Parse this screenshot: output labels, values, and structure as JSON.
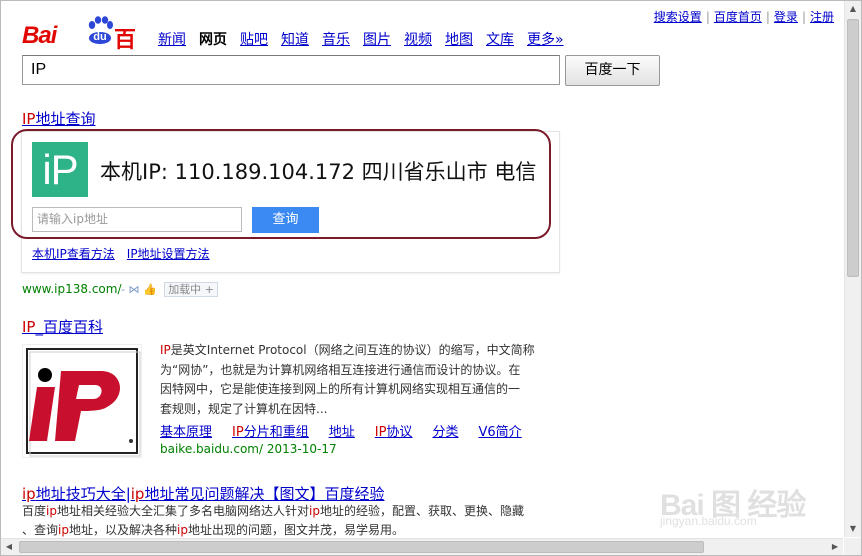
{
  "header": {
    "top_links": [
      "搜索设置",
      "百度首页",
      "登录",
      "注册"
    ],
    "logo": {
      "latin": "Bai",
      "du": "du",
      "chinese": "百度"
    },
    "nav": [
      {
        "label": "新闻",
        "active": false
      },
      {
        "label": "网页",
        "active": true
      },
      {
        "label": "贴吧",
        "active": false
      },
      {
        "label": "知道",
        "active": false
      },
      {
        "label": "音乐",
        "active": false
      },
      {
        "label": "图片",
        "active": false
      },
      {
        "label": "视频",
        "active": false
      },
      {
        "label": "地图",
        "active": false
      },
      {
        "label": "文库",
        "active": false
      },
      {
        "label": "更多»",
        "active": false
      }
    ]
  },
  "search": {
    "query": "IP",
    "button_label": "百度一下"
  },
  "result_ip": {
    "title_em": "IP",
    "title_rest": "地址查询",
    "logo_text": "iP",
    "ip_line": "本机IP: 110.189.104.172  四川省乐山市 电信",
    "input_placeholder": "请输入ip地址",
    "query_button": "查询",
    "links": [
      "本机IP查看方法",
      "IP地址设置方法"
    ],
    "cite": "www.ip138.com/",
    "cite_dash": "-",
    "loading_label": "加载中"
  },
  "result_baike": {
    "title_em": "IP",
    "title_rest": "_百度百科",
    "desc_lines": [
      {
        "em": "IP",
        "text": "是英文Internet Protocol（网络之间互连的协议）的缩写，中文简称"
      },
      {
        "em": "",
        "text": "为“网协”，也就是为计算机网络相互连接进行通信而设计的协议。在"
      },
      {
        "em": "",
        "text": "因特网中，它是能使连接到网上的所有计算机网络实现相互通信的一"
      },
      {
        "em": "",
        "text": "套规则，规定了计算机在因特..."
      }
    ],
    "links": [
      {
        "em": "",
        "text": "基本原理"
      },
      {
        "em": "IP",
        "text": "分片和重组"
      },
      {
        "em": "",
        "text": "地址"
      },
      {
        "em": "IP",
        "text": "协议"
      },
      {
        "em": "",
        "text": "分类"
      },
      {
        "em": "",
        "text": "V6简介"
      }
    ],
    "cite": "baike.baidu.com/ 2013-10-17",
    "image_label": "ip"
  },
  "result_jingyan": {
    "title_parts": [
      {
        "em": "ip",
        "text": "地址技巧大全|"
      },
      {
        "em": "ip",
        "text": "地址常见问题解决【图文】百度经验"
      }
    ],
    "desc_lines": [
      {
        "segments": [
          {
            "t": "百度"
          },
          {
            "em": "ip"
          },
          {
            "t": "地址相关经验大全汇集了多名电脑网络达人针对"
          },
          {
            "em": "ip"
          },
          {
            "t": "地址的经验，配置、获取、更换、隐藏"
          }
        ]
      },
      {
        "segments": [
          {
            "t": "、查询"
          },
          {
            "em": "ip"
          },
          {
            "t": "地址，以及解决各种"
          },
          {
            "em": "ip"
          },
          {
            "t": "地址出现的问题，图文并茂，易学易用。"
          }
        ]
      }
    ]
  },
  "watermark": {
    "main": "Bai 图 经验",
    "sub": "jingyan.baidu.com"
  },
  "colors": {
    "brand_red": "#e10601",
    "link_blue": "#0000cc",
    "cite_green": "#008000",
    "ip_green": "#2eb287",
    "query_blue": "#3b8af4",
    "highlight_ring": "#7b1a2b"
  }
}
